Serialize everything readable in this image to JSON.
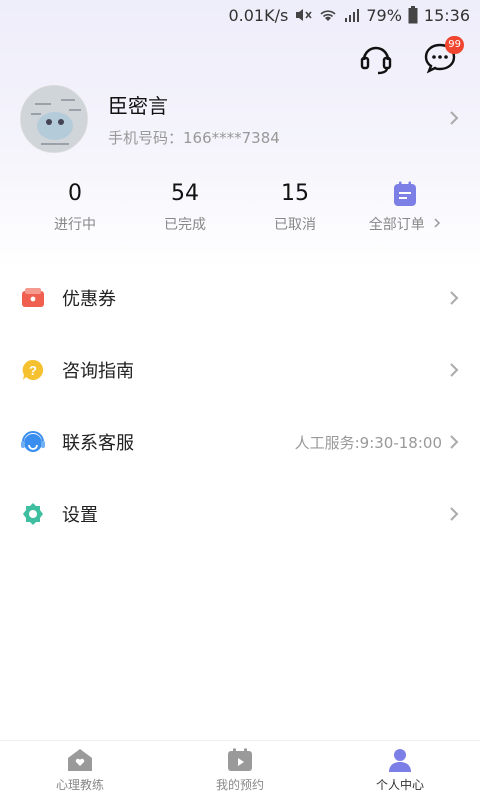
{
  "status": {
    "speed": "0.01K/s",
    "battery": "79%",
    "time": "15:36"
  },
  "topbar": {
    "message_badge": "99"
  },
  "profile": {
    "name": "臣密言",
    "phone": "手机号码：166****7384"
  },
  "stats": [
    {
      "value": "0",
      "label": "进行中"
    },
    {
      "value": "54",
      "label": "已完成"
    },
    {
      "value": "15",
      "label": "已取消"
    }
  ],
  "all_orders_label": "全部订单",
  "menu": [
    {
      "label": "优惠券",
      "extra": ""
    },
    {
      "label": "咨询指南",
      "extra": ""
    },
    {
      "label": "联系客服",
      "extra": "人工服务:9:30-18:00"
    },
    {
      "label": "设置",
      "extra": ""
    }
  ],
  "tabs": [
    {
      "label": "心理教练",
      "active": false
    },
    {
      "label": "我的预约",
      "active": false
    },
    {
      "label": "个人中心",
      "active": true
    }
  ],
  "colors": {
    "accent": "#7b7fe6",
    "badge": "#f0452f"
  }
}
